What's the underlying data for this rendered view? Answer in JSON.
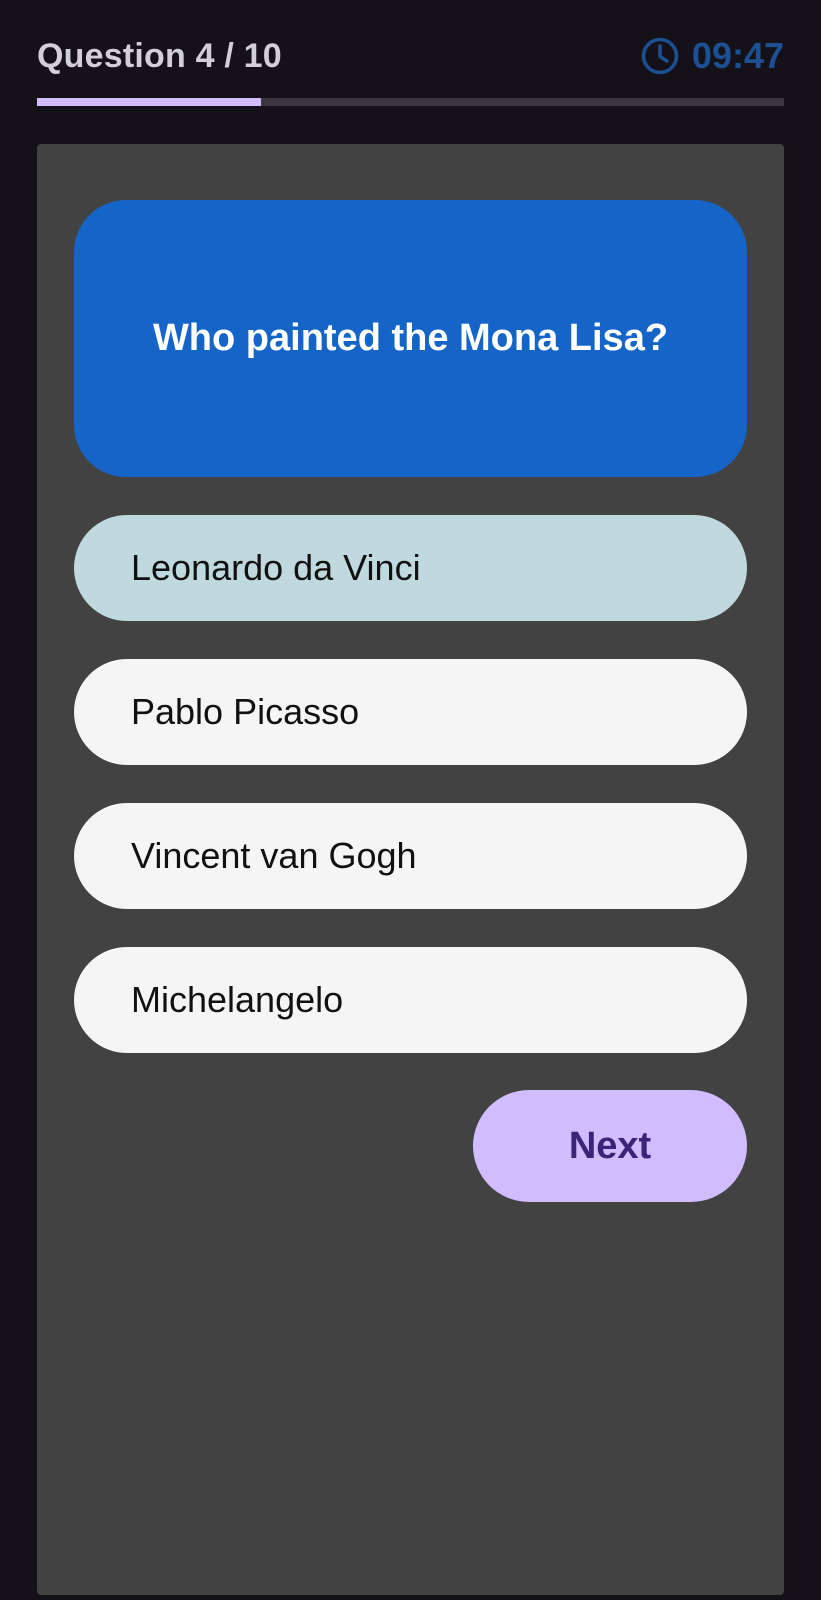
{
  "header": {
    "question_counter": "Question 4 / 10",
    "timer_icon": "clock-icon",
    "timer_value": "09:47"
  },
  "progress": {
    "fraction": 0.3
  },
  "question": {
    "text": "Who painted the Mona Lisa?"
  },
  "options": [
    {
      "label": "Leonardo da Vinci",
      "selected": true
    },
    {
      "label": "Pablo Picasso",
      "selected": false
    },
    {
      "label": "Vincent van Gogh",
      "selected": false
    },
    {
      "label": "Michelangelo",
      "selected": false
    }
  ],
  "actions": {
    "next_label": "Next"
  },
  "colors": {
    "accent": "#d0bcff",
    "question_bg": "#1565c8",
    "selected_option_bg": "#c0d9de",
    "timer": "#1d4f93"
  }
}
